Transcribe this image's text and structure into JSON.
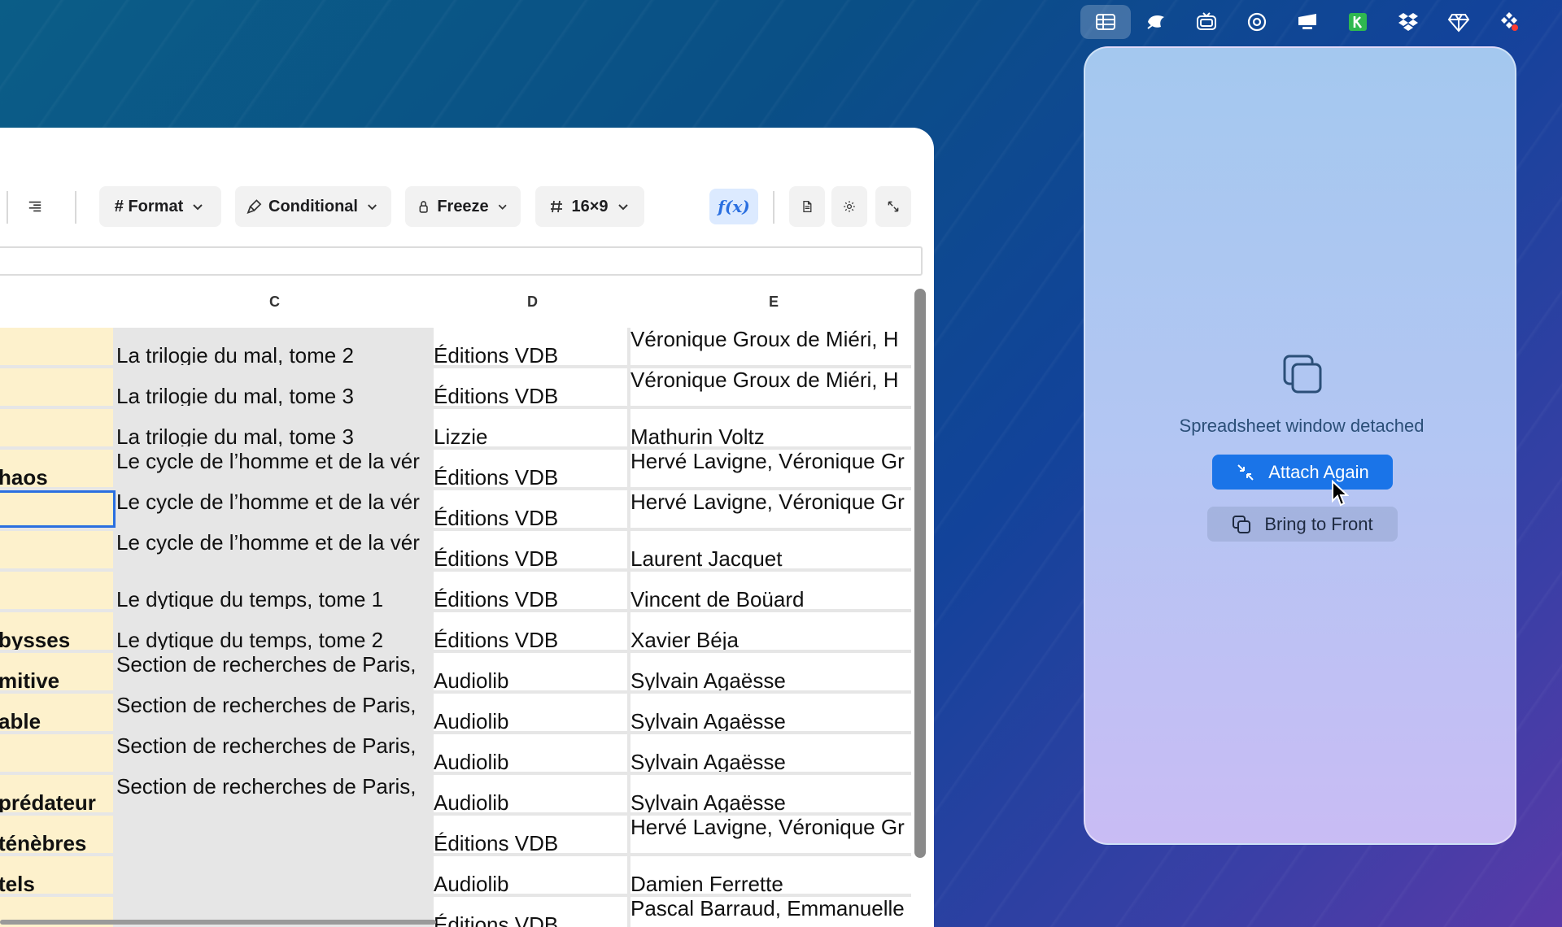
{
  "menubar": {
    "items": [
      {
        "icon": "spreadsheet-grid-icon",
        "active": true
      },
      {
        "icon": "leaf-icon",
        "active": false
      },
      {
        "icon": "tv-icon",
        "active": false
      },
      {
        "icon": "at-sign-icon",
        "active": false
      },
      {
        "icon": "monitor-icon",
        "active": false
      },
      {
        "icon": "keyboard-k-icon",
        "active": false
      },
      {
        "icon": "dropbox-icon",
        "active": false
      },
      {
        "icon": "gem-icon",
        "active": false
      },
      {
        "icon": "figma-icon",
        "active": false
      }
    ]
  },
  "toolbar": {
    "format_label": "# Format",
    "conditional_label": "Conditional",
    "freeze_label": "Freeze",
    "size_label": "16×9",
    "fx_label": "f(x)"
  },
  "columns": [
    "C",
    "D",
    "E"
  ],
  "rows": [
    {
      "b": "",
      "c": "La trilogie du mal, tome 2",
      "d": "Éditions VDB",
      "e": "Véronique Groux de Miéri, H",
      "c_wrap": false,
      "e_wrap": true
    },
    {
      "b": "",
      "c": "La trilogie du mal, tome 3",
      "d": "Éditions VDB",
      "e": "Véronique Groux de Miéri, H",
      "c_wrap": false,
      "e_wrap": true
    },
    {
      "b": "",
      "c": "La trilogie du mal, tome 3",
      "d": "Lizzie",
      "e": "Mathurin Voltz",
      "c_wrap": false,
      "e_wrap": false
    },
    {
      "b": "haos",
      "c": "Le cycle de l’homme et de la vér",
      "d": "Éditions VDB",
      "e": "Hervé Lavigne, Véronique Gr",
      "c_wrap": true,
      "e_wrap": true
    },
    {
      "b": "",
      "c": "Le cycle de l’homme et de la vér",
      "d": "Éditions VDB",
      "e": "Hervé Lavigne, Véronique Gr",
      "c_wrap": true,
      "e_wrap": true,
      "selected": true
    },
    {
      "b": "",
      "c": "Le cycle de l’homme et de la vér",
      "d": "Éditions VDB",
      "e": "Laurent Jacquet",
      "c_wrap": true,
      "e_wrap": false
    },
    {
      "b": "",
      "c": "Le dytique du temps, tome 1",
      "d": "Éditions VDB",
      "e": "Vincent de Boüard",
      "c_wrap": false,
      "e_wrap": false
    },
    {
      "b": "bysses",
      "c": "Le dytique du temps, tome 2",
      "d": "Éditions VDB",
      "e": "Xavier Béja",
      "c_wrap": false,
      "e_wrap": false
    },
    {
      "b": "mitive",
      "c": "Section de recherches de Paris,",
      "d": "Audiolib",
      "e": "Sylvain Agaësse",
      "c_wrap": true,
      "e_wrap": false
    },
    {
      "b": "able",
      "c": "Section de recherches de Paris,",
      "d": "Audiolib",
      "e": "Sylvain Agaësse",
      "c_wrap": true,
      "e_wrap": false
    },
    {
      "b": "",
      "c": "Section de recherches de Paris,",
      "d": "Audiolib",
      "e": "Sylvain Agaësse",
      "c_wrap": true,
      "e_wrap": false
    },
    {
      "b": "prédateur",
      "c": "Section de recherches de Paris,",
      "d": "Audiolib",
      "e": "Sylvain Agaësse",
      "c_wrap": true,
      "e_wrap": false
    },
    {
      "b": "ténèbres",
      "c": "",
      "d": "Éditions VDB",
      "e": "Hervé Lavigne, Véronique Gr",
      "c_wrap": false,
      "e_wrap": true
    },
    {
      "b": "tels",
      "c": "",
      "d": "Audiolib",
      "e": "Damien Ferrette",
      "c_wrap": false,
      "e_wrap": false
    },
    {
      "b": "",
      "c": "",
      "d": "Éditions VDB",
      "e": "Pascal Barraud, Emmanuelle",
      "c_wrap": false,
      "e_wrap": true
    }
  ],
  "panel": {
    "message": "Spreadsheet window detached",
    "attach_label": "Attach Again",
    "front_label": "Bring to Front"
  }
}
